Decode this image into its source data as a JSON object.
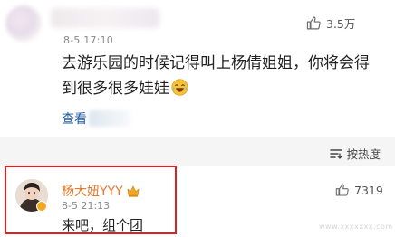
{
  "top_comment": {
    "time": "8-5 17:10",
    "likes": "3.5万",
    "text": "去游乐园的时候记得叫上杨倩姐姐，你将会得到很多很多娃娃",
    "view_more_label": "查看",
    "emoji": "laugh-crying-icon"
  },
  "sort": {
    "label": "按热度",
    "icon": "sort-icon"
  },
  "reply_comment": {
    "name": "杨大妞YYY",
    "badge": "crown-icon",
    "time": "8-5 21:13",
    "likes": "7319",
    "text": "来吧，组个团"
  },
  "watermark": "www.xxxxxxx.com",
  "colors": {
    "link": "#1e5aa8",
    "vip_name": "#e8792b",
    "highlight": "#e02020",
    "separator": "#f5f5f5"
  }
}
